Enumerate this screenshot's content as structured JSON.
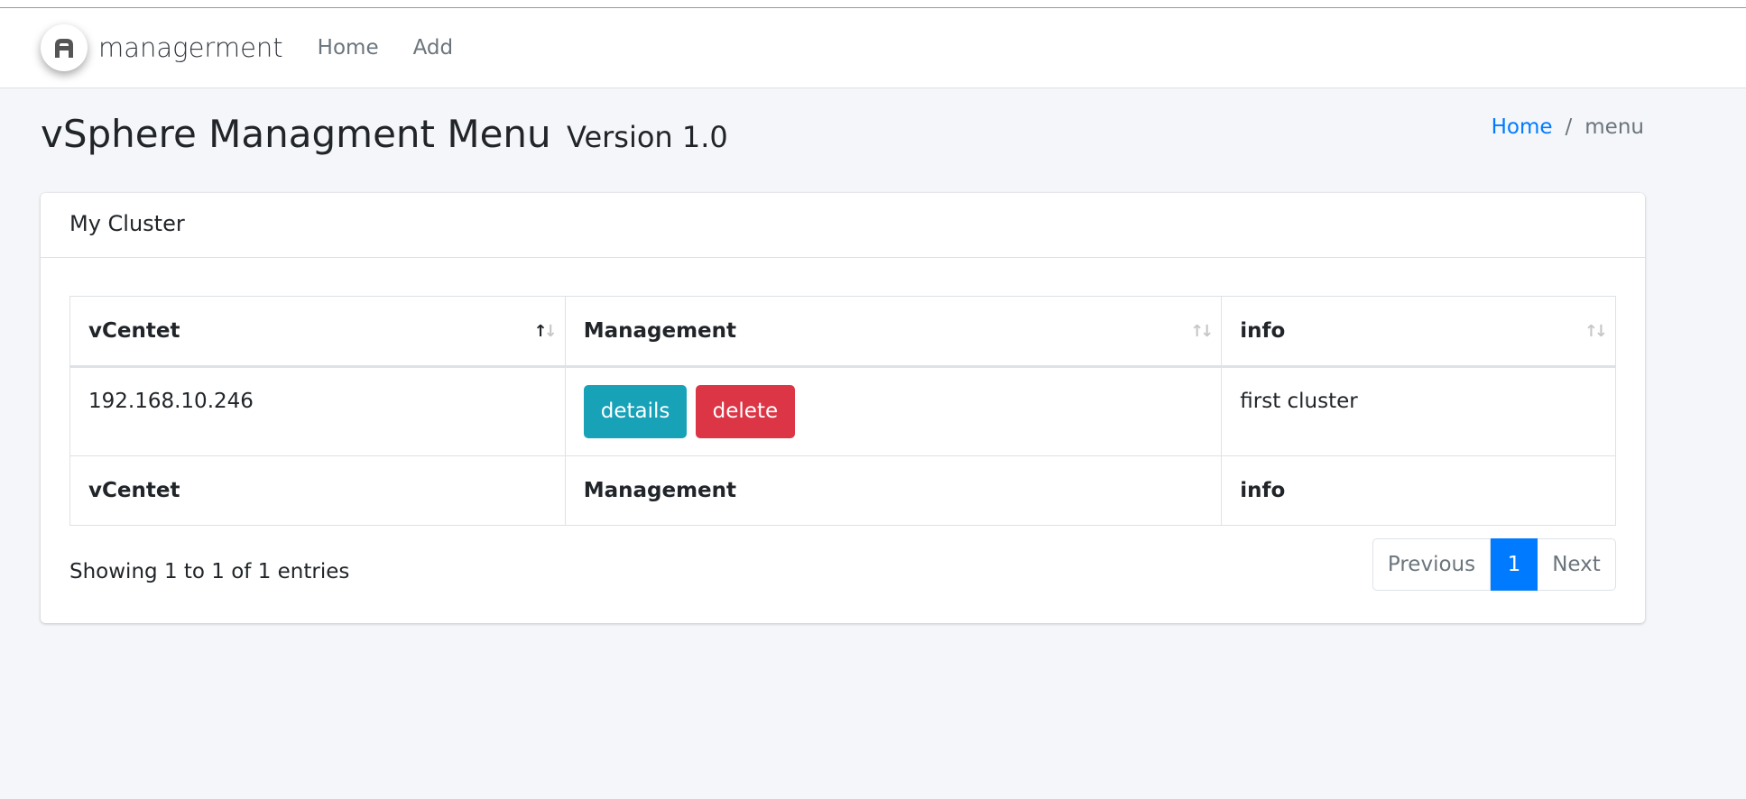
{
  "navbar": {
    "brand_text": "managerment",
    "links": [
      "Home",
      "Add"
    ]
  },
  "header": {
    "title": "vSphere Managment Menu",
    "version": "Version 1.0"
  },
  "breadcrumb": {
    "home": "Home",
    "separator": "/",
    "current": "menu"
  },
  "card": {
    "title": "My Cluster"
  },
  "table": {
    "columns": [
      "vCentet",
      "Management",
      "info"
    ],
    "sort_icon": "↑↓",
    "rows": [
      {
        "vcenter": "192.168.10.246",
        "info": "first cluster"
      }
    ],
    "buttons": {
      "details": "details",
      "delete": "delete"
    },
    "footer": [
      "vCentet",
      "Management",
      "info"
    ]
  },
  "pagination": {
    "summary": "Showing 1 to 1 of 1 entries",
    "previous": "Previous",
    "current_page": "1",
    "next": "Next"
  },
  "colors": {
    "primary": "#007bff",
    "info": "#17a2b8",
    "danger": "#dc3545",
    "background": "#f4f6f9"
  }
}
